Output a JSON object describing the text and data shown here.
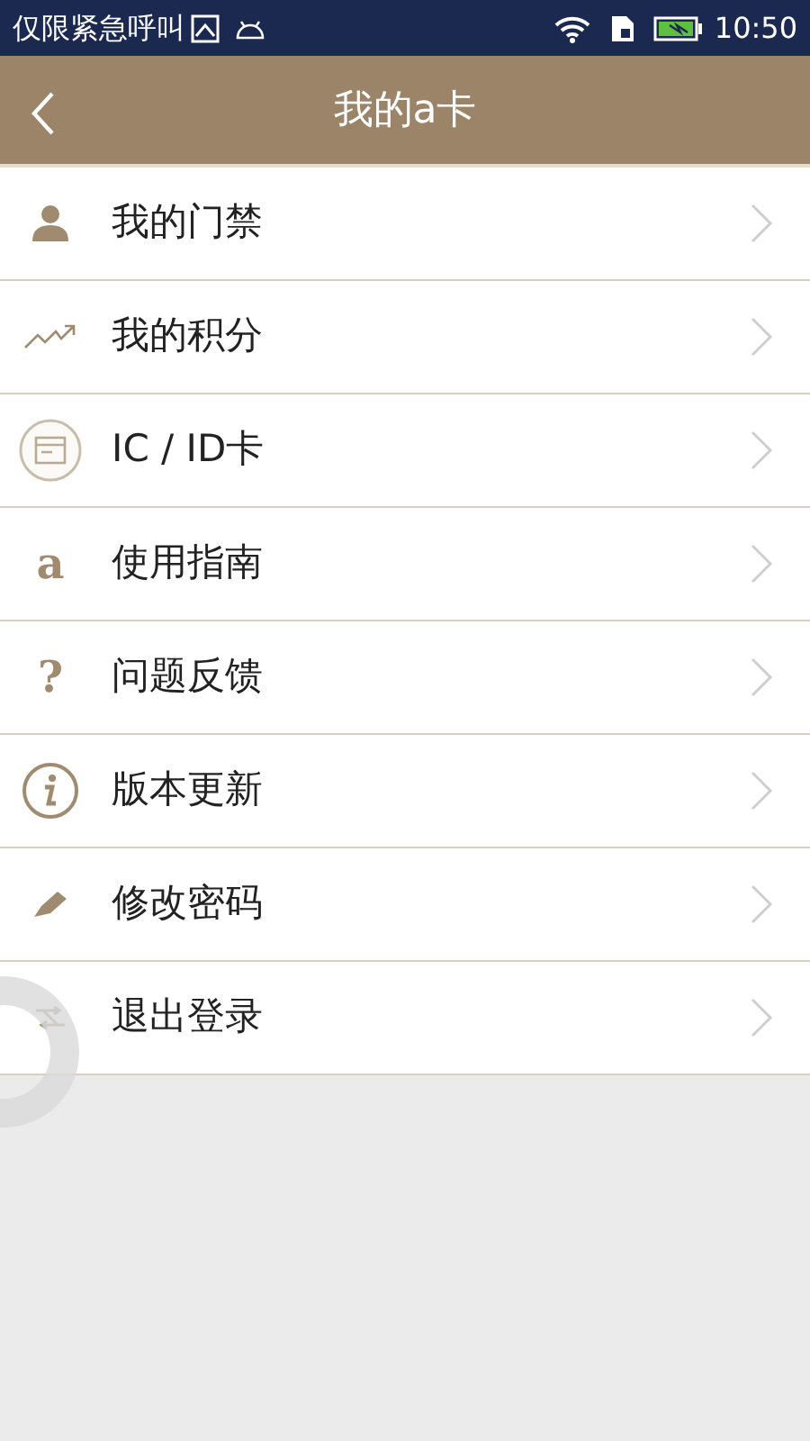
{
  "status_bar": {
    "carrier": "仅限紧急呼叫",
    "time": "10:50"
  },
  "header": {
    "title": "我的a卡"
  },
  "menu": [
    {
      "kind": "person",
      "label": "我的门禁"
    },
    {
      "kind": "trend",
      "label": "我的积分"
    },
    {
      "kind": "card",
      "label": "IC / ID卡"
    },
    {
      "kind": "glyph",
      "glyph": "a",
      "label": "使用指南"
    },
    {
      "kind": "glyph",
      "glyph": "?",
      "label": "问题反馈"
    },
    {
      "kind": "info",
      "label": "版本更新"
    },
    {
      "kind": "pen",
      "label": "修改密码"
    },
    {
      "kind": "swap",
      "label": "退出登录"
    }
  ]
}
